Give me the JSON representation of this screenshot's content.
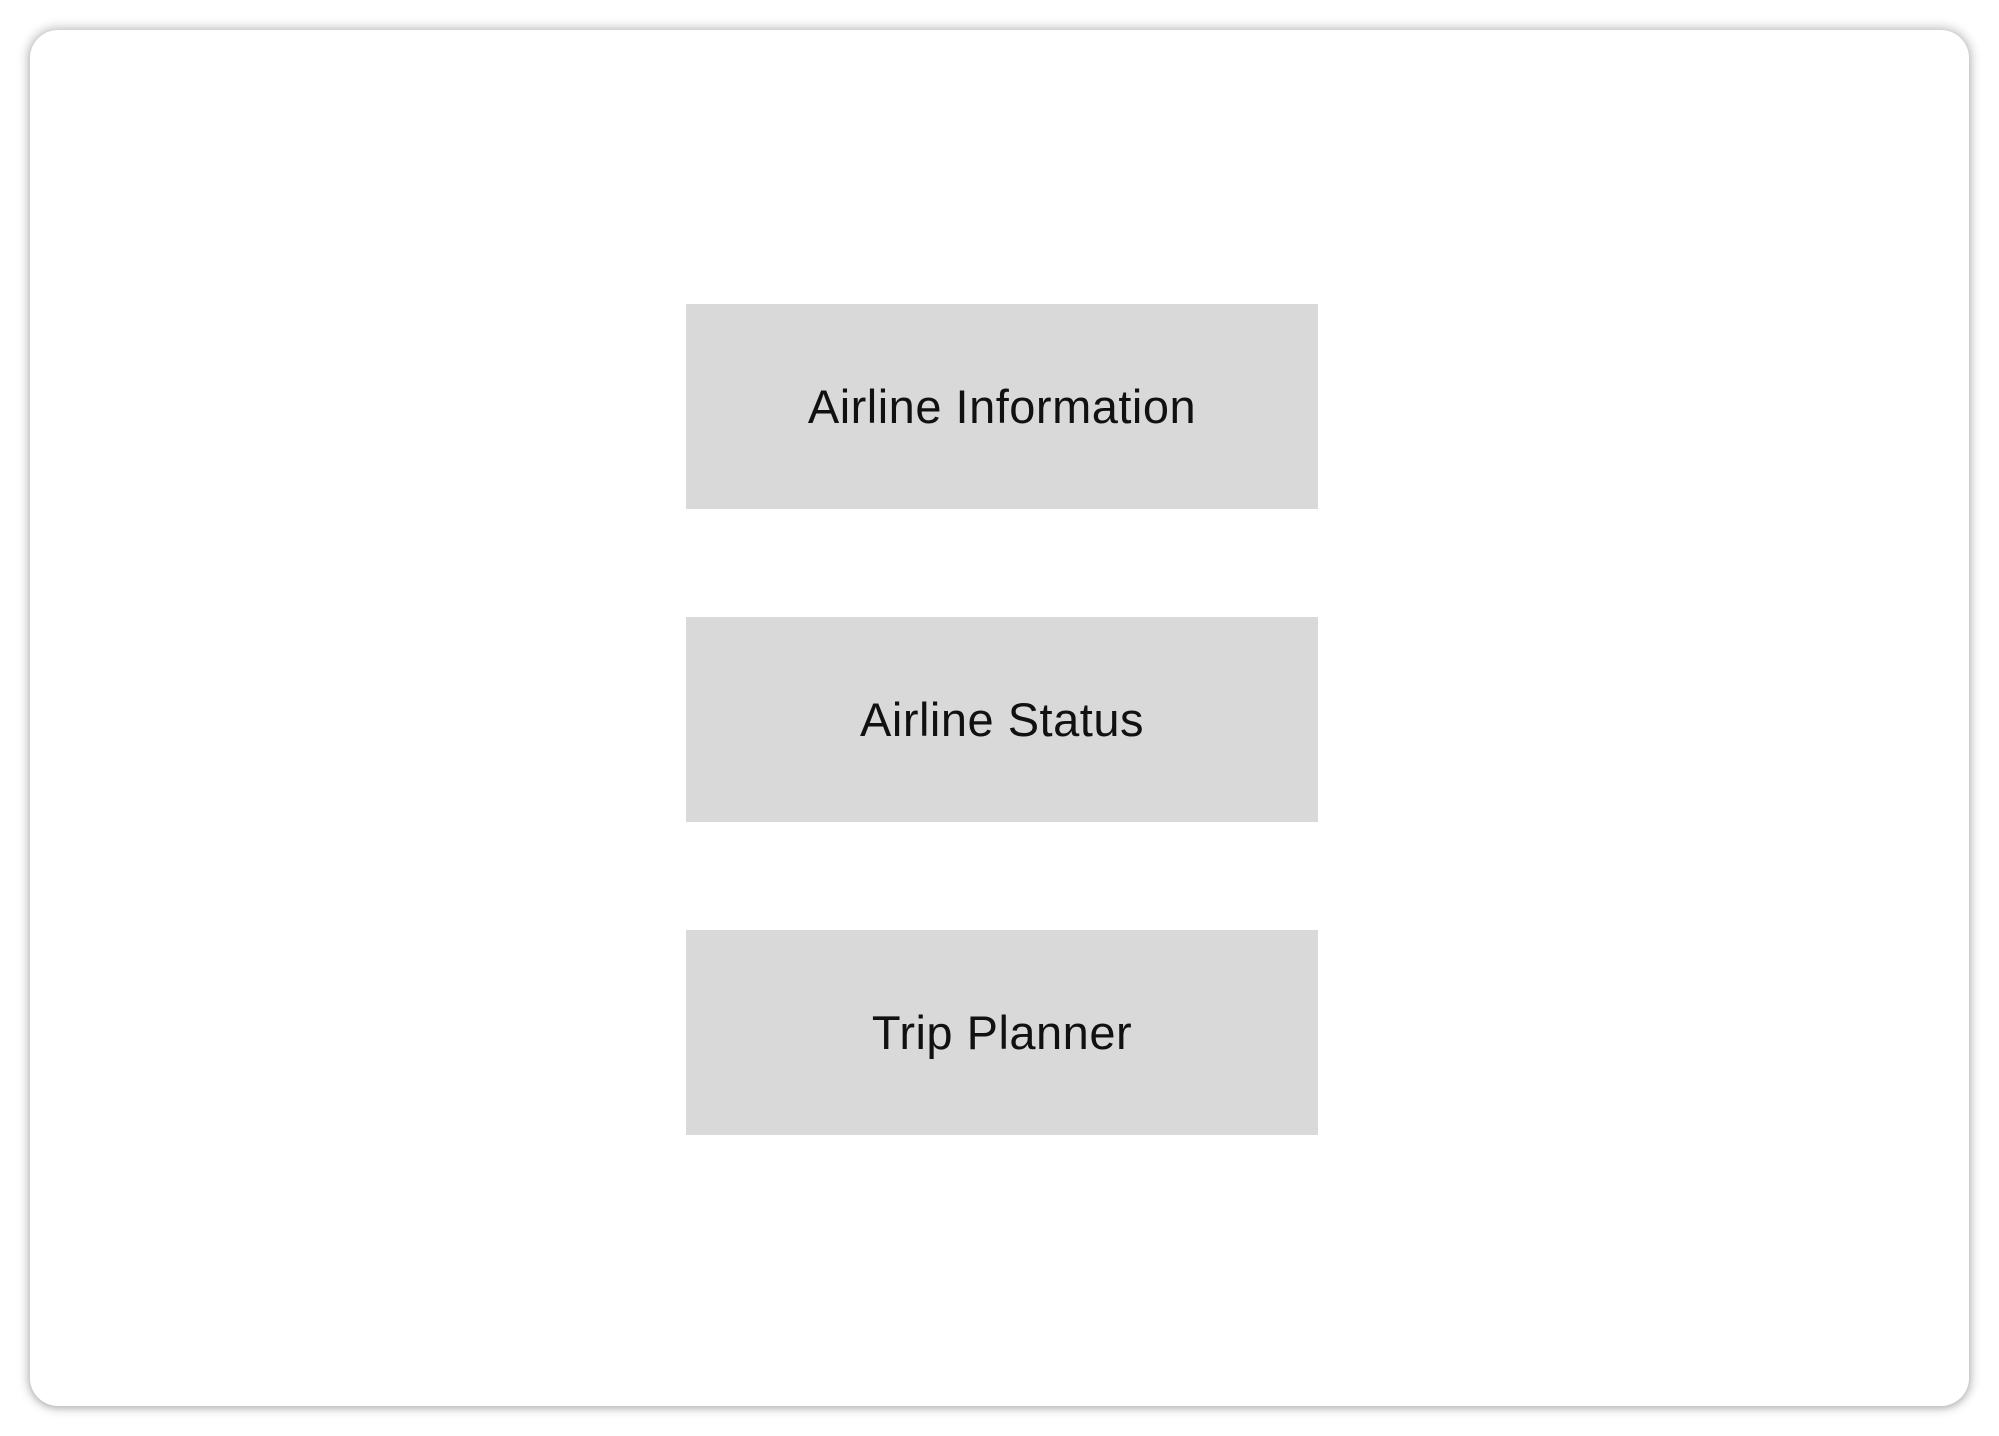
{
  "colors": {
    "background": "#ffffff",
    "button_fill": "#d9d9d9",
    "text": "#111111"
  },
  "menu": {
    "items": [
      {
        "label": "Airline Information"
      },
      {
        "label": "Airline Status"
      },
      {
        "label": "Trip Planner"
      }
    ]
  }
}
